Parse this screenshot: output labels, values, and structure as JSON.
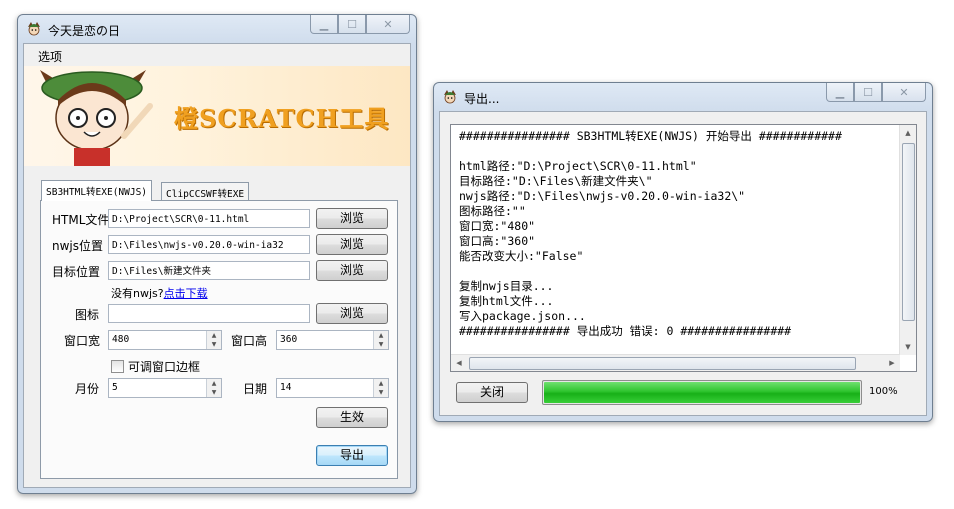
{
  "main_window": {
    "title": "今天是恋の日",
    "menu": [
      "选项"
    ],
    "banner_title": "橙SCRATCH工具",
    "tabs": [
      {
        "label": "SB3HTML转EXE(NWJS)",
        "active": true
      },
      {
        "label": "ClipCCSWF转EXE",
        "active": false
      }
    ],
    "form": {
      "html_label": "HTML文件",
      "html_value": "D:\\Project\\SCR\\0-11.html",
      "nwjs_label": "nwjs位置",
      "nwjs_value": "D:\\Files\\nwjs-v0.20.0-win-ia32",
      "target_label": "目标位置",
      "target_value": "D:\\Files\\新建文件夹",
      "browse_label": "浏览",
      "no_nwjs_text": "没有nwjs?",
      "download_link": "点击下载",
      "icon_label": "图标",
      "icon_value": "",
      "width_label": "窗口宽",
      "width_value": "480",
      "height_label": "窗口高",
      "height_value": "360",
      "resizable_label": "可调窗口边框",
      "resizable_checked": false,
      "month_label": "月份",
      "month_value": "5",
      "day_label": "日期",
      "day_value": "14",
      "apply_button": "生效",
      "export_button": "导出"
    }
  },
  "export_window": {
    "title": "导出...",
    "log_lines": [
      "################ SB3HTML转EXE(NWJS) 开始导出 ############",
      "",
      "html路径:\"D:\\Project\\SCR\\0-11.html\"",
      "目标路径:\"D:\\Files\\新建文件夹\\\"",
      "nwjs路径:\"D:\\Files\\nwjs-v0.20.0-win-ia32\\\"",
      "图标路径:\"\"",
      "窗口宽:\"480\"",
      "窗口高:\"360\"",
      "能否改变大小:\"False\"",
      "",
      "复制nwjs目录...",
      "复制html文件...",
      "写入package.json...",
      "################ 导出成功 错误: 0 ################"
    ],
    "close_button": "关闭",
    "progress": 100,
    "progress_text": "100%"
  },
  "colors": {
    "progress_green": "#22b922",
    "link_blue": "#0000ee",
    "banner_title_orange": "#f0a020"
  }
}
